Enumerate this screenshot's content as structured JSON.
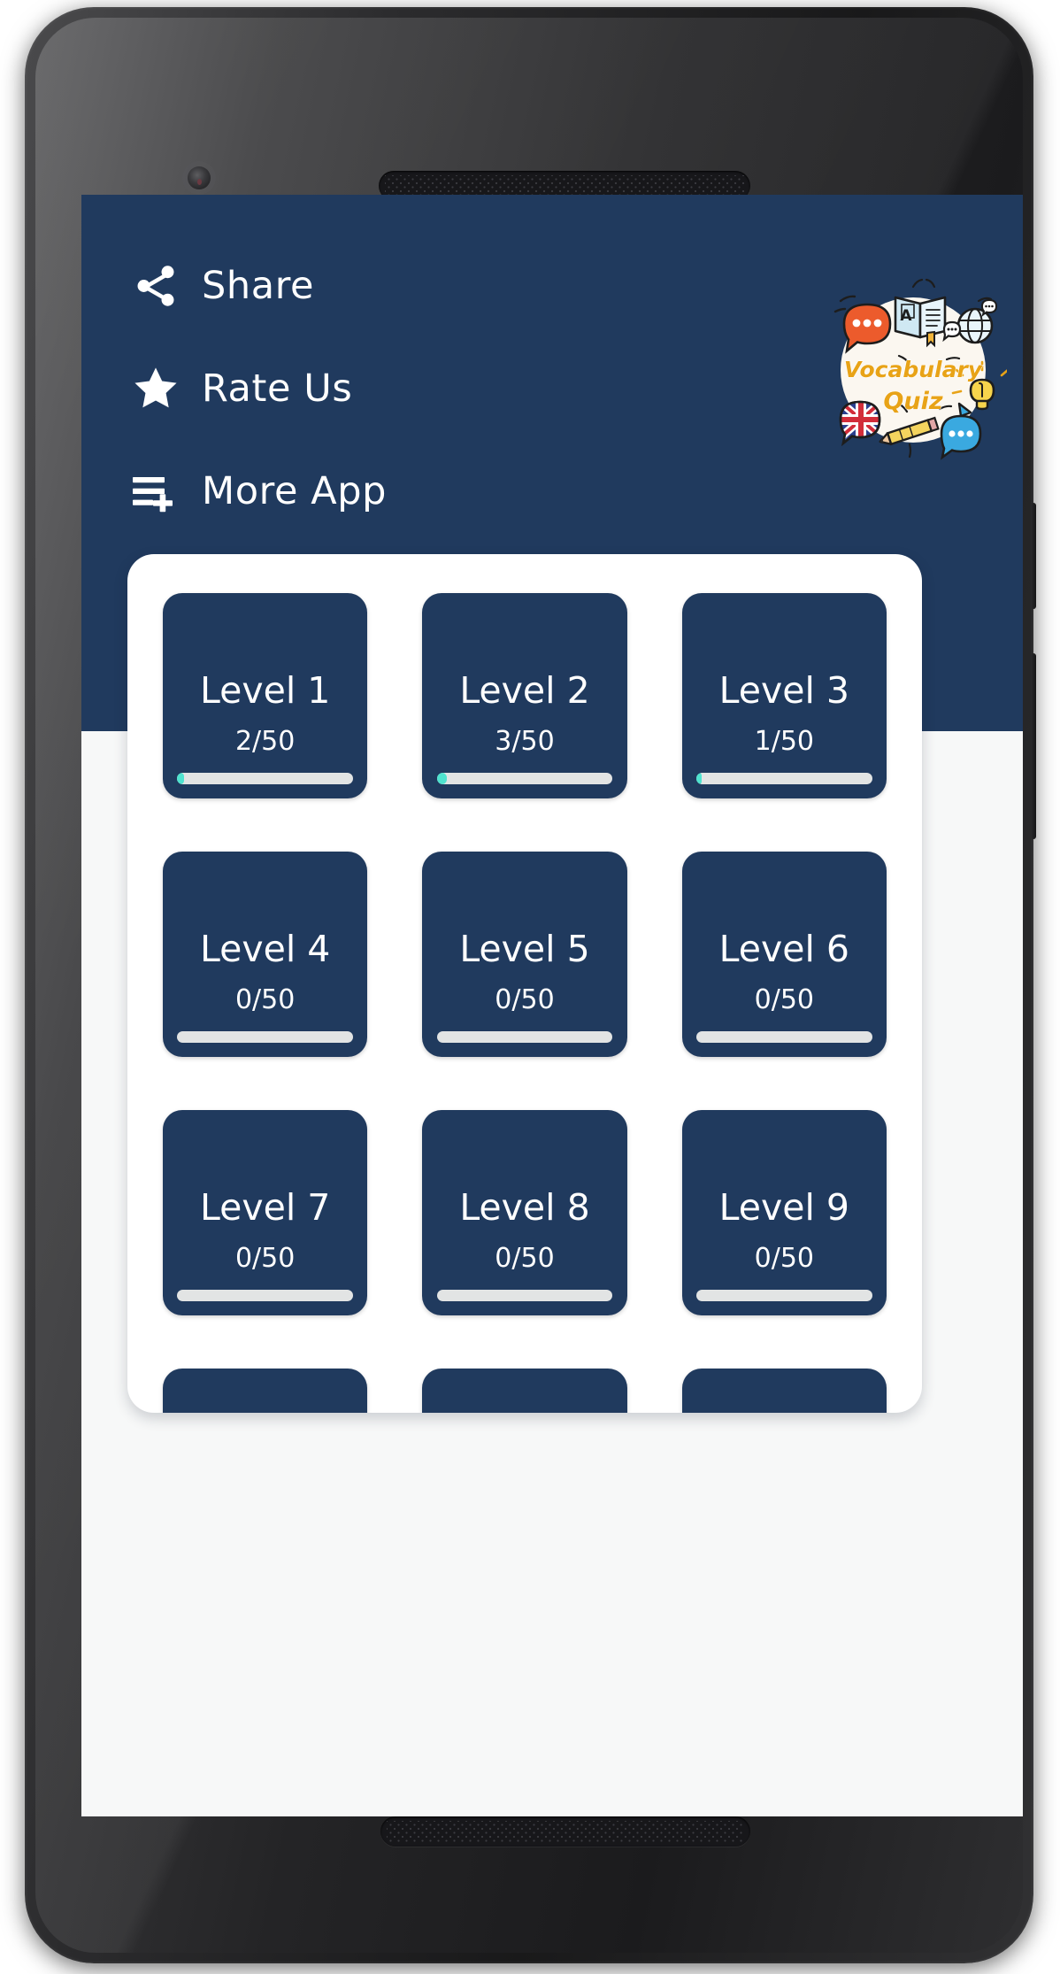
{
  "app": {
    "title": "Vocabulary Quiz",
    "logo_line1": "Vocabulary",
    "logo_line2": "Quiz",
    "colors": {
      "header_navy": "#203a5e",
      "card_navy": "#203a5e",
      "panel_white": "#ffffff",
      "page_background": "#f7f8f8",
      "progress_fill_teal": "#4fe3cf",
      "progress_track_gray": "#e2e4e4",
      "logo_text_orange": "#e8a317",
      "logo_circle_cream": "#fbf7f0",
      "bubble_orange": "#ec5b2c",
      "bubble_blue": "#3aa9e0",
      "book_blue": "#cfe8f3",
      "bulb_yellow": "#f7d44c"
    }
  },
  "menu": {
    "items": [
      {
        "label": "Share",
        "icon": "share-icon"
      },
      {
        "label": "Rate Us",
        "icon": "star-icon"
      },
      {
        "label": "More App",
        "icon": "playlist-add-icon"
      }
    ]
  },
  "levels": [
    {
      "title": "Level 1",
      "score": "2/50",
      "completed": 2,
      "total": 50,
      "progress_pct": 4
    },
    {
      "title": "Level 2",
      "score": "3/50",
      "completed": 3,
      "total": 50,
      "progress_pct": 6
    },
    {
      "title": "Level 3",
      "score": "1/50",
      "completed": 1,
      "total": 50,
      "progress_pct": 2
    },
    {
      "title": "Level 4",
      "score": "0/50",
      "completed": 0,
      "total": 50,
      "progress_pct": 0
    },
    {
      "title": "Level 5",
      "score": "0/50",
      "completed": 0,
      "total": 50,
      "progress_pct": 0
    },
    {
      "title": "Level 6",
      "score": "0/50",
      "completed": 0,
      "total": 50,
      "progress_pct": 0
    },
    {
      "title": "Level 7",
      "score": "0/50",
      "completed": 0,
      "total": 50,
      "progress_pct": 0
    },
    {
      "title": "Level 8",
      "score": "0/50",
      "completed": 0,
      "total": 50,
      "progress_pct": 0
    },
    {
      "title": "Level 9",
      "score": "0/50",
      "completed": 0,
      "total": 50,
      "progress_pct": 0
    },
    {
      "title": "",
      "score": "",
      "completed": 0,
      "total": 50,
      "progress_pct": 0
    },
    {
      "title": "",
      "score": "",
      "completed": 0,
      "total": 50,
      "progress_pct": 0
    },
    {
      "title": "",
      "score": "",
      "completed": 0,
      "total": 50,
      "progress_pct": 0
    }
  ],
  "device": {
    "type": "android-phone-mockup",
    "bezel_color": "#252527"
  }
}
